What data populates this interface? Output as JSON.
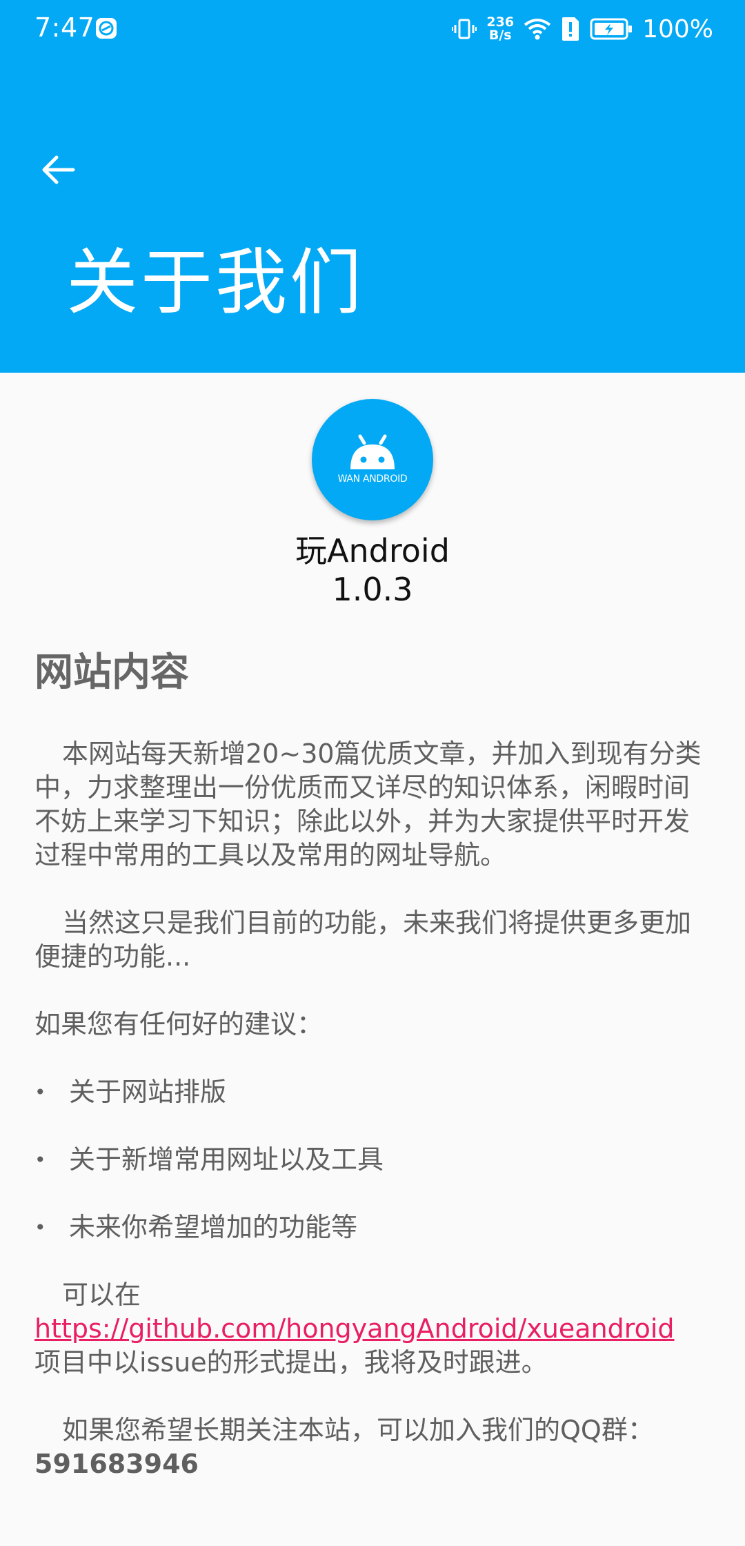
{
  "status_bar": {
    "time": "7:47",
    "net_speed_value": "236",
    "net_speed_unit": "B/s",
    "battery_percent": "100%"
  },
  "header": {
    "title": "关于我们"
  },
  "app": {
    "logo_text": "WAN ANDROID",
    "name": "玩Android",
    "version": "1.0.3"
  },
  "content": {
    "heading": "网站内容",
    "paragraph1": "本网站每天新增20~30篇优质文章，并加入到现有分类中，力求整理出一份优质而又详尽的知识体系，闲暇时间不妨上来学习下知识；除此以外，并为大家提供平时开发过程中常用的工具以及常用的网址导航。",
    "paragraph2": "当然这只是我们目前的功能，未来我们将提供更多更加便捷的功能...",
    "suggestion_intro": "如果您有任何好的建议：",
    "bullets": [
      "关于网站排版",
      "关于新增常用网址以及工具",
      "未来你希望增加的功能等"
    ],
    "issue_prefix": "可以在",
    "repo_link": "https://github.com/hongyangAndroid/xueandroid",
    "issue_suffix": "项目中以issue的形式提出，我将及时跟进。",
    "qq_text": "如果您希望长期关注本站，可以加入我们的QQ群：",
    "qq_number": "591683946"
  },
  "colors": {
    "primary": "#03a9f4",
    "link": "#e91e63",
    "background": "#fafafa",
    "body_text": "#5f5f5f"
  },
  "icons": {
    "back": "arrow-left-icon",
    "logo": "android-robot-icon"
  }
}
